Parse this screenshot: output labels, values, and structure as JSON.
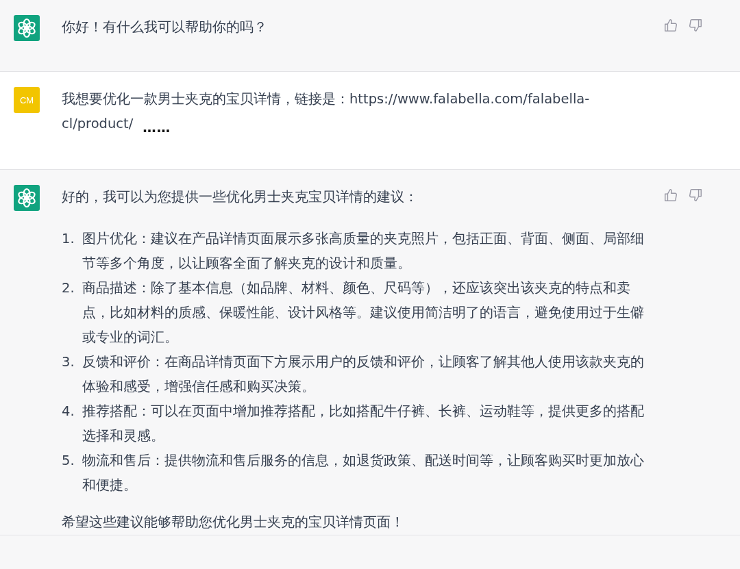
{
  "messages": [
    {
      "kind": "assistant",
      "text": "你好！有什么我可以帮助你的吗？"
    },
    {
      "kind": "user",
      "avatar": "CM",
      "text": "我想要优化一款男士夹克的宝贝详情，链接是：https://www.falabella.com/falabella-cl/product/",
      "trailing": "……"
    },
    {
      "kind": "assistant",
      "text": "好的，我可以为您提供一些优化男士夹克宝贝详情的建议：",
      "list": [
        {
          "number": "1.",
          "text": "图片优化：建议在产品详情页面展示多张高质量的夹克照片，包括正面、背面、侧面、局部细节等多个角度，以让顾客全面了解夹克的设计和质量。"
        },
        {
          "number": "2.",
          "text": "商品描述：除了基本信息（如品牌、材料、颜色、尺码等），还应该突出该夹克的特点和卖点，比如材料的质感、保暖性能、设计风格等。建议使用简洁明了的语言，避免使用过于生僻或专业的词汇。"
        },
        {
          "number": "3.",
          "text": "反馈和评价：在商品详情页面下方展示用户的反馈和评价，让顾客了解其他人使用该款夹克的体验和感受，增强信任感和购买决策。"
        },
        {
          "number": "4.",
          "text": "推荐搭配：可以在页面中增加推荐搭配，比如搭配牛仔裤、长裤、运动鞋等，提供更多的搭配选择和灵感。"
        },
        {
          "number": "5.",
          "text": "物流和售后：提供物流和售后服务的信息，如退货政策、配送时间等，让顾客购买时更加放心和便捷。"
        }
      ],
      "closing": "希望这些建议能够帮助您优化男士夹克的宝贝详情页面！"
    }
  ]
}
